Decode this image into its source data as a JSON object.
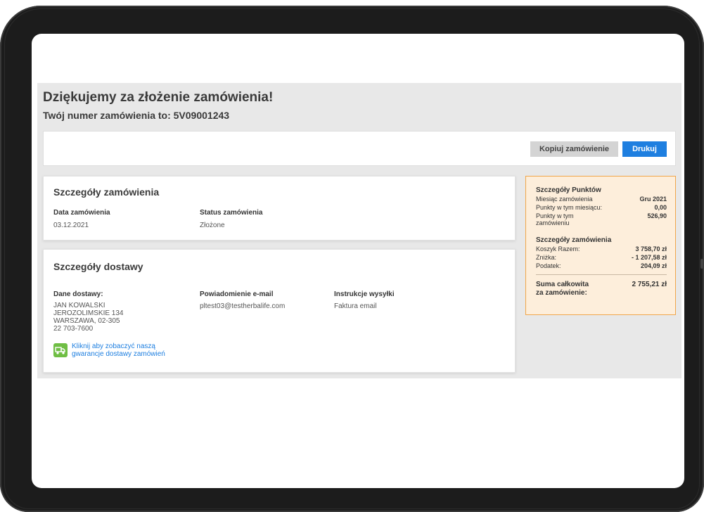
{
  "page": {
    "title": "Dziękujemy za złożenie zamówienia!",
    "order_number_text": "Twój numer zamówienia to: 5V09001243"
  },
  "actions": {
    "copy_label": "Kopiuj zamówienie",
    "print_label": "Drukuj"
  },
  "order_details": {
    "title": "Szczegóły zamówienia",
    "date_label": "Data zamówienia",
    "date_value": "03.12.2021",
    "status_label": "Status zamówienia",
    "status_value": "Złożone"
  },
  "delivery": {
    "title": "Szczegóły dostawy",
    "address_label": "Dane dostawy:",
    "address_lines": [
      "JAN KOWALSKI",
      "JEROZOLIMSKIE 134",
      "WARSZAWA, 02-305",
      "22 703-7600"
    ],
    "email_label": "Powiadomienie e-mail",
    "email_value": "pltest03@testherbalife.com",
    "shipping_label": "Instrukcje wysyłki",
    "shipping_value": "Faktura email",
    "guarantee_link": "Kliknij aby zobaczyć naszą gwarancje dostawy zamówień"
  },
  "points": {
    "title": "Szczegóły Punktów",
    "month_label": "Miesiąc zamówienia",
    "month_value": "Gru 2021",
    "month_points_label": "Punkty w tym miesiącu:",
    "month_points_value": "0,00",
    "order_points_label_1": "Punkty w tym",
    "order_points_label_2": "zamówieniu",
    "order_points_value": "526,90"
  },
  "summary": {
    "title": "Szczegóły zamówienia",
    "cart_label": "Koszyk Razem:",
    "cart_value": "3 758,70 zł",
    "discount_label": "Zniżka:",
    "discount_value": "- 1 207,58 zł",
    "tax_label": "Podatek:",
    "tax_value": "204,09 zł",
    "total_label_1": "Suma całkowita",
    "total_label_2": "za zamówienie:",
    "total_value": "2 755,21 zł"
  },
  "colors": {
    "primary": "#1e7fe0",
    "points_bg": "#fdeedb",
    "points_border": "#f0a64a",
    "guarantee_icon": "#6fbe44"
  },
  "icons": {
    "guarantee": "delivery-truck-icon"
  }
}
